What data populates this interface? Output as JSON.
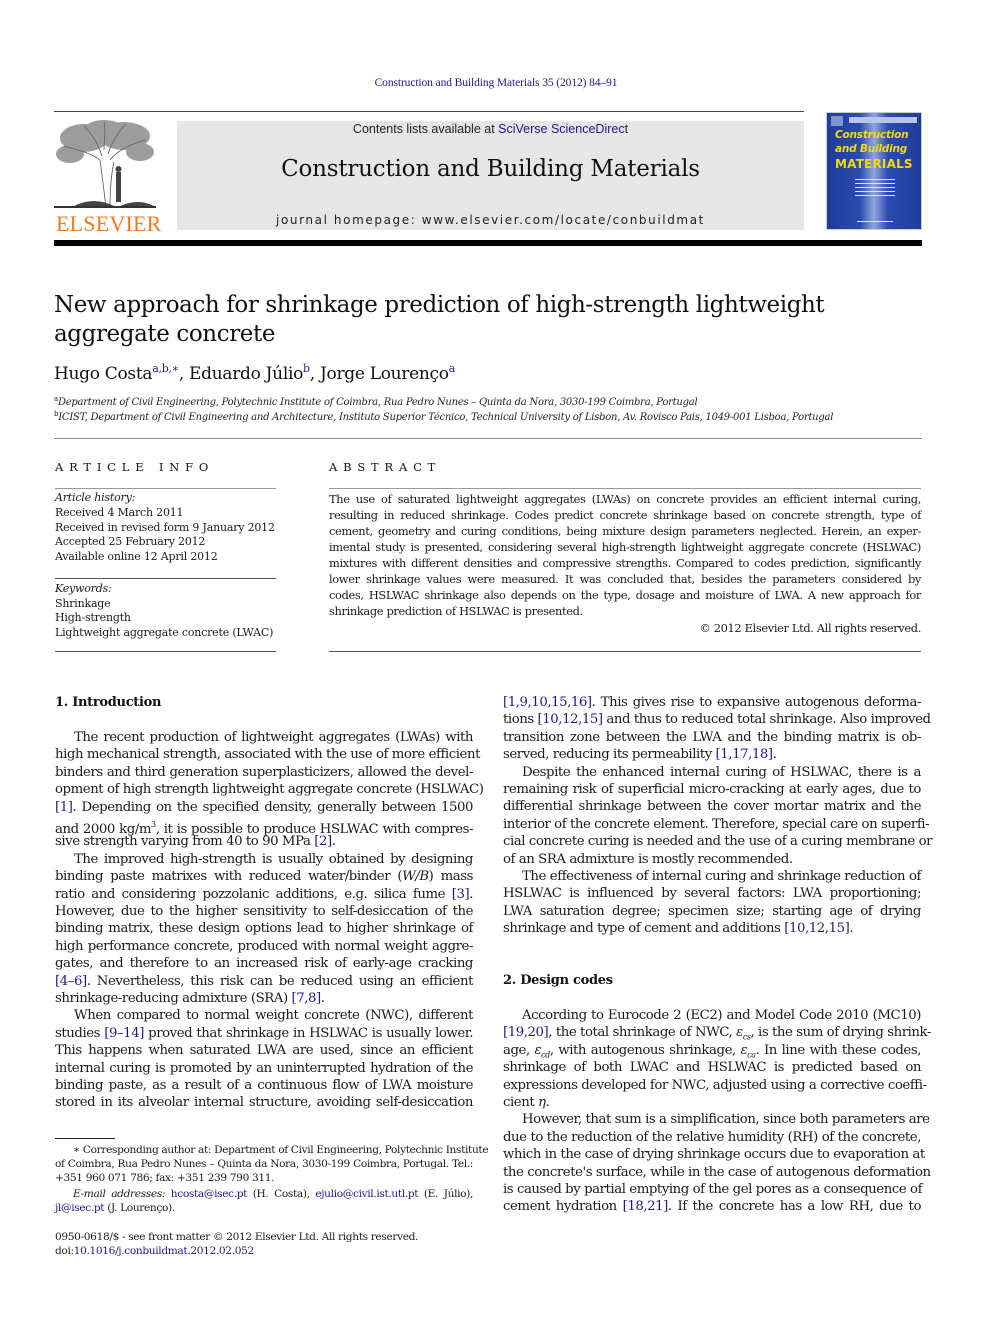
{
  "header": {
    "citation": "Construction and Building Materials 35 (2012) 84–91",
    "contents_prefix": "Contents lists available at ",
    "contents_link": "SciVerse ScienceDirect",
    "journal_name": "Construction and Building Materials",
    "homepage": "journal homepage: www.elsevier.com/locate/conbuildmat",
    "publisher_logo_text": "ELSEVIER",
    "cover": {
      "line1": "Construction",
      "line2": "and Building",
      "line3": "MATERIALS"
    },
    "colors": {
      "link_blue": "#1a1a8c",
      "elsevier_orange": "#f07a1f",
      "band_grey": "#e6e6e6",
      "cover_blue": "#2a4bb0",
      "cover_yellow": "#f5d90a"
    }
  },
  "article": {
    "title_line1": "New approach for shrinkage prediction of high-strength lightweight",
    "title_line2": "aggregate concrete",
    "authors": [
      {
        "name": "Hugo Costa",
        "affil": "a,b,∗"
      },
      {
        "name": "Eduardo Júlio",
        "affil": "b"
      },
      {
        "name": "Jorge Lourenço",
        "affil": "a"
      }
    ],
    "affiliations": [
      {
        "key": "a",
        "text": "Department of Civil Engineering, Polytechnic Institute of Coimbra, Rua Pedro Nunes – Quinta da Nora, 3030-199 Coimbra, Portugal"
      },
      {
        "key": "b",
        "text": "ICIST, Department of Civil Engineering and Architecture, Instituto Superior Técnico, Technical University of Lisbon, Av. Rovisco Pais, 1049-001 Lisboa, Portugal"
      }
    ]
  },
  "article_info": {
    "heading": "ARTICLE INFO",
    "history_label": "Article history:",
    "history": [
      "Received 4 March 2011",
      "Received in revised form 9 January 2012",
      "Accepted 25 February 2012",
      "Available online 12 April 2012"
    ],
    "keywords_label": "Keywords:",
    "keywords": [
      "Shrinkage",
      "High-strength",
      "Lightweight aggregate concrete (LWAC)"
    ]
  },
  "abstract": {
    "heading": "ABSTRACT",
    "lines": [
      "The use of saturated lightweight aggregates (LWAs) on concrete provides an efficient internal curing,",
      "resulting in reduced shrinkage. Codes predict concrete shrinkage based on concrete strength, type of",
      "cement, geometry and curing conditions, being mixture design parameters neglected. Herein, an exper-",
      "imental study is presented, considering several high-strength lightweight aggregate concrete (HSLWAC)",
      "mixtures with different densities and compressive strengths. Compared to codes prediction, significantly",
      "lower shrinkage values were measured. It was concluded that, besides the parameters considered by",
      "codes, HSLWAC shrinkage also depends on the type, dosage and moisture of LWA. A new approach for",
      "shrinkage prediction of HSLWAC is presented."
    ],
    "copyright": "© 2012 Elsevier Ltd. All rights reserved."
  },
  "body": {
    "sec1_heading": "1. Introduction",
    "sec2_heading": "2. Design codes",
    "left_lines": [
      {
        "segs": [
          {
            "t": "The recent production of lightweight aggregates (LWAs) with"
          }
        ],
        "indent": true
      },
      {
        "segs": [
          {
            "t": "high mechanical strength, associated with the use of more efficient"
          }
        ]
      },
      {
        "segs": [
          {
            "t": "binders and third generation superplasticizers, allowed the devel-"
          }
        ]
      },
      {
        "segs": [
          {
            "t": "opment of high strength lightweight aggregate concrete (HSLWAC)"
          }
        ]
      },
      {
        "segs": [
          {
            "t": "[1]",
            "ref": true
          },
          {
            "t": ". Depending on the specified density, generally between 1500"
          }
        ]
      },
      {
        "segs": [
          {
            "t": "and 2000 kg/m"
          },
          {
            "t": "3",
            "sup": true
          },
          {
            "t": ", it is possible to produce HSLWAC with compres-"
          }
        ]
      },
      {
        "segs": [
          {
            "t": "sive strength varying from 40 to 90 MPa "
          },
          {
            "t": "[2]",
            "ref": true
          },
          {
            "t": "."
          }
        ],
        "last": true
      },
      {
        "segs": [
          {
            "t": "The improved high-strength is usually obtained by designing"
          }
        ],
        "indent": true
      },
      {
        "segs": [
          {
            "t": "binding paste matrixes with reduced water/binder ("
          },
          {
            "t": "W/B",
            "it": true
          },
          {
            "t": ") mass"
          }
        ]
      },
      {
        "segs": [
          {
            "t": "ratio and considering pozzolanic additions, e.g. silica fume "
          },
          {
            "t": "[3]",
            "ref": true
          },
          {
            "t": "."
          }
        ]
      },
      {
        "segs": [
          {
            "t": "However, due to the higher sensitivity to self-desiccation of the"
          }
        ]
      },
      {
        "segs": [
          {
            "t": "binding matrix, these design options lead to higher shrinkage of"
          }
        ]
      },
      {
        "segs": [
          {
            "t": "high performance concrete, produced with normal weight aggre-"
          }
        ]
      },
      {
        "segs": [
          {
            "t": "gates, and therefore to an increased risk of early-age cracking"
          }
        ]
      },
      {
        "segs": [
          {
            "t": "[4–6]",
            "ref": true
          },
          {
            "t": ". Nevertheless, this risk can be reduced using an efficient"
          }
        ]
      },
      {
        "segs": [
          {
            "t": "shrinkage-reducing admixture (SRA) "
          },
          {
            "t": "[7,8]",
            "ref": true
          },
          {
            "t": "."
          }
        ],
        "last": true
      },
      {
        "segs": [
          {
            "t": "When compared to normal weight concrete (NWC), different"
          }
        ],
        "indent": true
      },
      {
        "segs": [
          {
            "t": "studies "
          },
          {
            "t": "[9–14]",
            "ref": true
          },
          {
            "t": " proved that shrinkage in HSLWAC is usually lower."
          }
        ]
      },
      {
        "segs": [
          {
            "t": "This happens when saturated LWA are used, since an efficient"
          }
        ]
      },
      {
        "segs": [
          {
            "t": "internal curing is promoted by an uninterrupted hydration of the"
          }
        ]
      },
      {
        "segs": [
          {
            "t": "binding paste, as a result of a continuous flow of LWA moisture"
          }
        ]
      },
      {
        "segs": [
          {
            "t": "stored in its alveolar internal structure, avoiding self-desiccation"
          }
        ]
      }
    ],
    "right_lines_a": [
      {
        "segs": [
          {
            "t": "[1,9,10,15,16]",
            "ref": true
          },
          {
            "t": ". This gives rise to expansive autogenous deforma-"
          }
        ]
      },
      {
        "segs": [
          {
            "t": "tions "
          },
          {
            "t": "[10,12,15]",
            "ref": true
          },
          {
            "t": " and thus to reduced total shrinkage. Also improved"
          }
        ]
      },
      {
        "segs": [
          {
            "t": "transition zone between the LWA and the binding matrix is ob-"
          }
        ]
      },
      {
        "segs": [
          {
            "t": "served, reducing its permeability "
          },
          {
            "t": "[1,17,18]",
            "ref": true
          },
          {
            "t": "."
          }
        ],
        "last": true
      },
      {
        "segs": [
          {
            "t": "Despite the enhanced internal curing of HSLWAC, there is a"
          }
        ],
        "indent": true
      },
      {
        "segs": [
          {
            "t": "remaining risk of superficial micro-cracking at early ages, due to"
          }
        ]
      },
      {
        "segs": [
          {
            "t": "differential shrinkage between the cover mortar matrix and the"
          }
        ]
      },
      {
        "segs": [
          {
            "t": "interior of the concrete element. Therefore, special care on superfi-"
          }
        ]
      },
      {
        "segs": [
          {
            "t": "cial concrete curing is needed and the use of a curing membrane or"
          }
        ]
      },
      {
        "segs": [
          {
            "t": "of an SRA admixture is mostly recommended."
          }
        ],
        "last": true
      },
      {
        "segs": [
          {
            "t": "The effectiveness of internal curing and shrinkage reduction of"
          }
        ],
        "indent": true
      },
      {
        "segs": [
          {
            "t": "HSLWAC is influenced by several factors: LWA proportioning;"
          }
        ]
      },
      {
        "segs": [
          {
            "t": "LWA saturation degree; specimen size; starting age of drying"
          }
        ]
      },
      {
        "segs": [
          {
            "t": "shrinkage and type of cement and additions "
          },
          {
            "t": "[10,12,15]",
            "ref": true
          },
          {
            "t": "."
          }
        ],
        "last": true
      }
    ],
    "right_lines_b": [
      {
        "segs": [
          {
            "t": "According to Eurocode 2 (EC2) and Model Code 2010 (MC10)"
          }
        ],
        "indent": true
      },
      {
        "segs": [
          {
            "t": "[19,20]",
            "ref": true
          },
          {
            "t": ", the total shrinkage of NWC, "
          },
          {
            "t": "ε",
            "it": true
          },
          {
            "t": "cs",
            "sub": true
          },
          {
            "t": ", is the sum of drying shrink-"
          }
        ]
      },
      {
        "segs": [
          {
            "t": "age, "
          },
          {
            "t": "ε",
            "it": true
          },
          {
            "t": "cd",
            "sub": true
          },
          {
            "t": ", with autogenous shrinkage, "
          },
          {
            "t": "ε",
            "it": true
          },
          {
            "t": "ca",
            "sub": true
          },
          {
            "t": ". In line with these codes,"
          }
        ]
      },
      {
        "segs": [
          {
            "t": "shrinkage of both LWAC and HSLWAC is predicted based on"
          }
        ]
      },
      {
        "segs": [
          {
            "t": "expressions developed for NWC, adjusted using a corrective coeffi-"
          }
        ]
      },
      {
        "segs": [
          {
            "t": "cient "
          },
          {
            "t": "η",
            "it": true
          },
          {
            "t": "."
          }
        ],
        "last": true
      },
      {
        "segs": [
          {
            "t": "However, that sum is a simplification, since both parameters are"
          }
        ],
        "indent": true
      },
      {
        "segs": [
          {
            "t": "due to the reduction of the relative humidity (RH) of the concrete,"
          }
        ]
      },
      {
        "segs": [
          {
            "t": "which in the case of drying shrinkage occurs due to evaporation at"
          }
        ]
      },
      {
        "segs": [
          {
            "t": "the concrete's surface, while in the case of autogenous deformation"
          }
        ]
      },
      {
        "segs": [
          {
            "t": "is caused by partial emptying of the gel pores as a consequence of"
          }
        ]
      },
      {
        "segs": [
          {
            "t": "cement hydration "
          },
          {
            "t": "[18,21]",
            "ref": true
          },
          {
            "t": ". If the concrete has a low RH, due to"
          }
        ]
      }
    ]
  },
  "footnotes": {
    "corresponding": [
      {
        "segs": [
          {
            "t": "∗ Corresponding author at: Department of Civil Engineering, Polytechnic Institute"
          }
        ],
        "indent": true
      },
      {
        "segs": [
          {
            "t": "of Coimbra, Rua Pedro Nunes – Quinta da Nora, 3030-199 Coimbra, Portugal. Tel.:"
          }
        ]
      },
      {
        "segs": [
          {
            "t": "+351 960 071 786; fax: +351 239 790 311."
          }
        ],
        "last": true
      }
    ],
    "emails": [
      {
        "segs": [
          {
            "t": "E-mail addresses:",
            "it": true
          },
          {
            "t": " "
          },
          {
            "t": "hcosta@isec.pt",
            "ref": true
          },
          {
            "t": " (H. Costa), "
          },
          {
            "t": "ejulio@civil.ist.utl.pt",
            "ref": true
          },
          {
            "t": " (E. Júlio),"
          }
        ],
        "indent": true
      },
      {
        "segs": [
          {
            "t": "jl@isec.pt",
            "ref": true
          },
          {
            "t": " (J. Lourenço)."
          }
        ],
        "last": true
      }
    ],
    "issn_line": "0950-0618/$ - see front matter © 2012 Elsevier Ltd. All rights reserved.",
    "doi_prefix": "doi:",
    "doi_link": "10.1016/j.conbuildmat.2012.02.052"
  }
}
